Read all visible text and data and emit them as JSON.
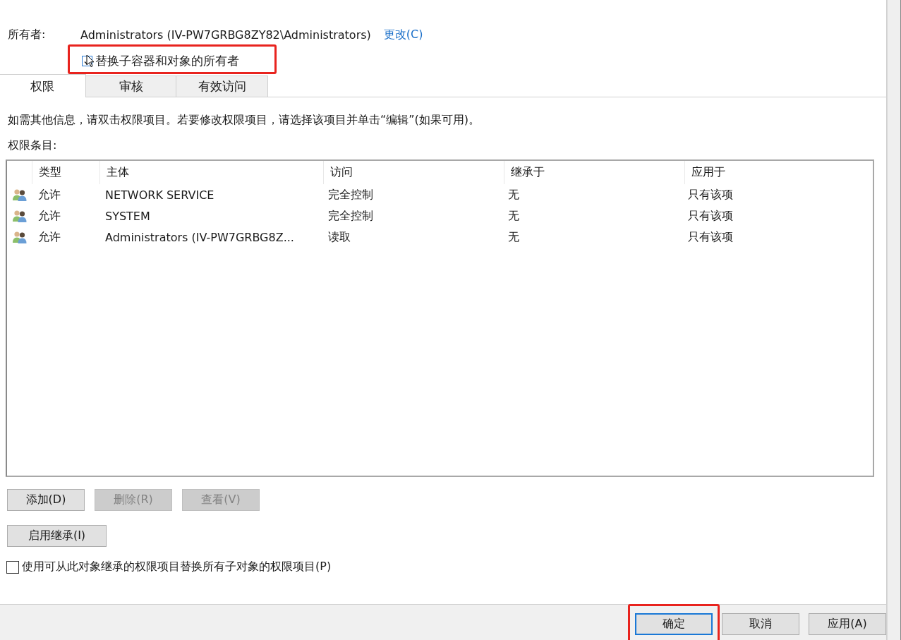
{
  "owner": {
    "label": "所有者:",
    "value": "Administrators (IV-PW7GRBG8ZY82\\Administrators)",
    "change_link": "更改(C)"
  },
  "replace_owner": {
    "label": "替换子容器和对象的所有者",
    "checked": true,
    "highlighted": true
  },
  "tabs": [
    {
      "label": "权限",
      "selected": true
    },
    {
      "label": "审核",
      "selected": false
    },
    {
      "label": "有效访问",
      "selected": false
    }
  ],
  "info_text": "如需其他信息，请双击权限项目。若要修改权限项目，请选择该项目并单击“编辑”(如果可用)。",
  "entries_label": "权限条目:",
  "table": {
    "columns": [
      "类型",
      "主体",
      "访问",
      "继承于",
      "应用于"
    ],
    "rows": [
      {
        "type": "允许",
        "principal": "NETWORK SERVICE",
        "access": "完全控制",
        "inherited_from": "无",
        "applies_to": "只有该项"
      },
      {
        "type": "允许",
        "principal": "SYSTEM",
        "access": "完全控制",
        "inherited_from": "无",
        "applies_to": "只有该项"
      },
      {
        "type": "允许",
        "principal": "Administrators (IV-PW7GRBG8Z...",
        "access": "读取",
        "inherited_from": "无",
        "applies_to": "只有该项"
      }
    ]
  },
  "entry_buttons": [
    {
      "label": "添加(D)",
      "disabled": false
    },
    {
      "label": "删除(R)",
      "disabled": true
    },
    {
      "label": "查看(V)",
      "disabled": true
    }
  ],
  "inheritance_button": {
    "label": "启用继承(I)",
    "disabled": false
  },
  "replace_child_permissions": {
    "label": "使用可从此对象继承的权限项目替换所有子对象的权限项目(P)",
    "checked": false
  },
  "footer_buttons": [
    {
      "label": "确定",
      "default": true,
      "highlighted": true
    },
    {
      "label": "取消",
      "default": false,
      "highlighted": false
    },
    {
      "label": "应用(A)",
      "default": false,
      "highlighted": false
    }
  ]
}
